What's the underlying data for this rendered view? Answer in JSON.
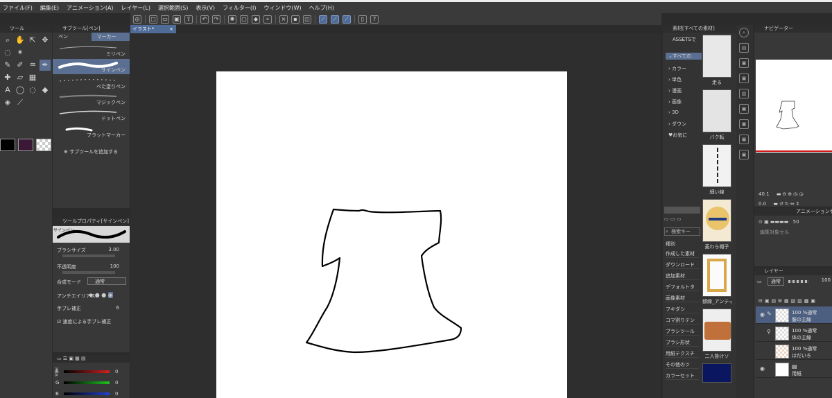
{
  "menu": [
    "ファイル(F)",
    "編集(E)",
    "アニメーション(A)",
    "レイヤー(L)",
    "選択範囲(S)",
    "表示(V)",
    "フィルター(I)",
    "ウィンドウ(W)",
    "ヘルプ(H)"
  ],
  "tools_panel": {
    "title": "ツール"
  },
  "subtool_panel": {
    "title": "サブツール[ペン]",
    "tabs": [
      "ペン",
      "マーカー"
    ],
    "brushes": [
      "ミリペン",
      "サインペン",
      "べた塗りペン",
      "マジックペン",
      "ドットペン",
      "フラットマーカー"
    ],
    "add_label": "サブツールを追加する"
  },
  "tool_property": {
    "title": "ツールプロパティ[サインペン]",
    "preview_label": "サインペン",
    "brush_size_label": "ブラシサイズ",
    "brush_size_value": "3.00",
    "opacity_label": "不透明度",
    "opacity_value": "100",
    "blend_label": "合成モード",
    "blend_value": "通常",
    "antialias_label": "アンチエイリアス",
    "stabilization_label": "手ブレ補正",
    "stabilization_value": "6",
    "speed_stab_label": "速度による手ブレ補正"
  },
  "color_panel": {
    "mode_label": "RGB",
    "rows": [
      {
        "label": "R",
        "value": "0",
        "color": "#d22020"
      },
      {
        "label": "G",
        "value": "0",
        "color": "#20c020"
      },
      {
        "label": "B",
        "value": "0",
        "color": "#2040d8"
      }
    ]
  },
  "document_tab": "イラスト*",
  "material_panel": {
    "title": "素材[すべての素材]",
    "assets_label": "ASSETSで",
    "tree": [
      "すべての",
      "カラー",
      "単色",
      "漫画",
      "画像",
      "3D",
      "ダウン",
      "お気に"
    ],
    "thumbs": [
      "走る",
      "バク転",
      "細い線",
      "麦わら帽子",
      "額縁_アンティ",
      "二人掛けソ"
    ],
    "search_placeholder": "検索キー",
    "category_label": "種別",
    "categories": [
      "作成した素材",
      "ダウンロード",
      "追加素材",
      "デフォルトタ",
      "画像素材",
      "フキダシ",
      "コマ割りテン",
      "ブラシツール",
      "ブラシ形状",
      "用紙テクスチ",
      "その他のツ",
      "カラーセット"
    ]
  },
  "navigator": {
    "title": "ナビゲーター",
    "zoom_value": "40.1",
    "rotate_value": "0.0"
  },
  "anim_cel": {
    "title": "アニメーションセル",
    "value": "50",
    "label": "編集対象セル"
  },
  "layer_panel": {
    "title": "レイヤー",
    "blend": "通常",
    "opacity": "100",
    "layers": [
      {
        "pct": "100 %通常",
        "name": "服の主線"
      },
      {
        "pct": "100 %通常",
        "name": "体の主線"
      },
      {
        "pct": "100 %通常",
        "name": "はだいろ"
      },
      {
        "pct": "",
        "name": "用紙"
      }
    ]
  }
}
